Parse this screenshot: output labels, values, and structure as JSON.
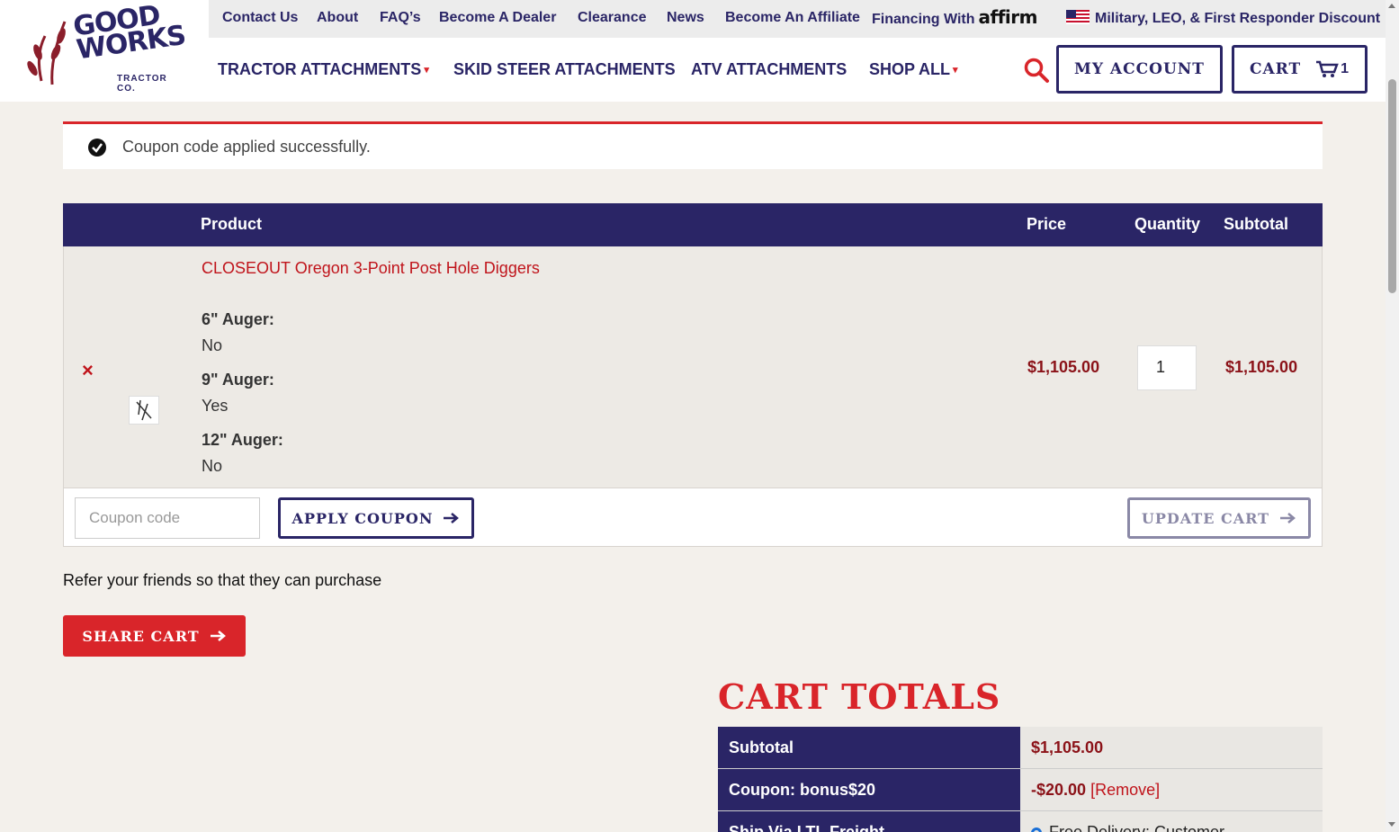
{
  "brand": {
    "logo_line1": "GOOD",
    "logo_line2": "WORKS",
    "logo_sub": "TRACTOR CO."
  },
  "topbar": {
    "contact": "Contact Us",
    "about": "About",
    "faqs": "FAQ’s",
    "dealer": "Become A Dealer",
    "clearance": "Clearance",
    "news": "News",
    "affiliate": "Become An Affiliate",
    "financing": "Financing With",
    "affirm": "affirm",
    "military": "Military, LEO, & First Responder Discount"
  },
  "mainnav": {
    "tractor": "TRACTOR ATTACHMENTS",
    "skid": "SKID STEER ATTACHMENTS",
    "atv": "ATV ATTACHMENTS",
    "shop": "SHOP ALL",
    "caret": "▾"
  },
  "header_buttons": {
    "account": "MY ACCOUNT",
    "cart": "CART",
    "cart_count": "1"
  },
  "notice": {
    "message": "Coupon code applied successfully."
  },
  "cart": {
    "headers": {
      "product": "Product",
      "price": "Price",
      "quantity": "Quantity",
      "subtotal": "Subtotal"
    },
    "item": {
      "name": "CLOSEOUT Oregon 3-Point Post Hole Diggers",
      "remove": "×",
      "attributes": [
        {
          "label": "6\" Auger:",
          "value": "No"
        },
        {
          "label": "9\" Auger:",
          "value": "Yes"
        },
        {
          "label": "12\" Auger:",
          "value": "No"
        }
      ],
      "price": "$1,105.00",
      "quantity": "1",
      "subtotal": "$1,105.00"
    },
    "coupon_placeholder": "Coupon code",
    "apply_coupon": "APPLY COUPON",
    "update_cart": "UPDATE CART"
  },
  "share": {
    "refer_text": "Refer your friends so that they can purchase",
    "button": "SHARE CART"
  },
  "totals": {
    "title": "CART TOTALS",
    "rows": [
      {
        "label": "Subtotal",
        "value": "$1,105.00"
      },
      {
        "label": "Coupon: bonus$20",
        "value": "-$20.00",
        "action": "[Remove]"
      },
      {
        "label": "Ship Via LTL Freight",
        "value": "Free Delivery: Customer"
      }
    ]
  },
  "colors": {
    "navy": "#2a2566",
    "red": "#d9252a",
    "price": "#8b1218"
  }
}
